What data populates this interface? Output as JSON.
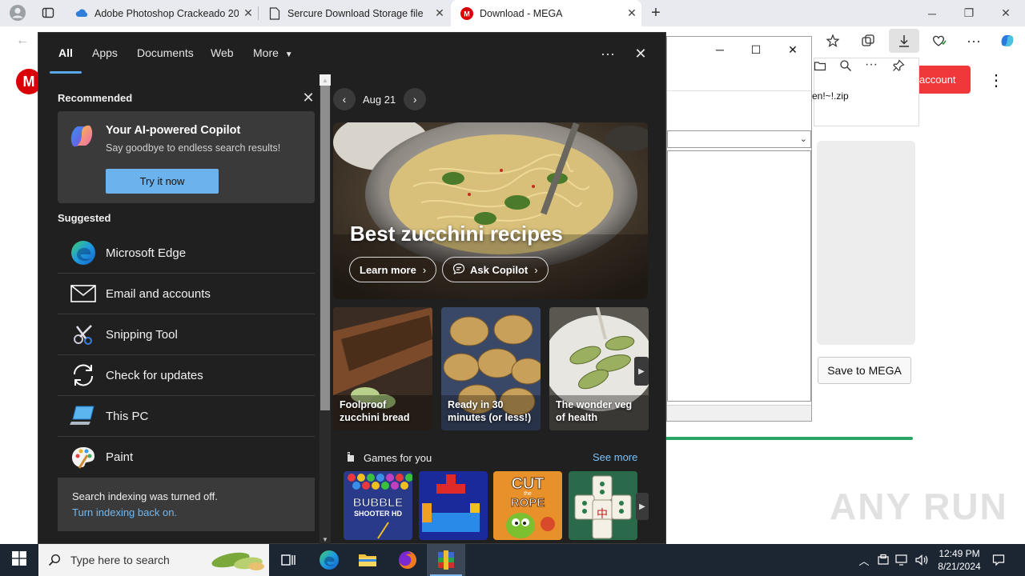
{
  "browser": {
    "tabs": [
      {
        "title": "Adobe Photoshop Crackeado 20",
        "active": false
      },
      {
        "title": "Sercure Download Storage file",
        "active": false
      },
      {
        "title": "Download - MEGA",
        "active": true
      }
    ],
    "new_tab": "+"
  },
  "mega": {
    "logo": "M",
    "account_button": "account",
    "save_button": "Save to MEGA",
    "progress_percent": 100
  },
  "download_window": {
    "filename": "en!~!.zip"
  },
  "flyout": {
    "nav": {
      "tabs": [
        "All",
        "Apps",
        "Documents",
        "Web",
        "More"
      ],
      "more_menu": "···",
      "close": "✕"
    },
    "recommended": {
      "heading": "Recommended",
      "card_title": "Your AI-powered Copilot",
      "card_subtitle": "Say goodbye to endless search results!",
      "card_button": "Try it now"
    },
    "suggested": {
      "heading": "Suggested",
      "items": [
        {
          "label": "Microsoft Edge",
          "icon": "edge-icon"
        },
        {
          "label": "Email and accounts",
          "icon": "mail-icon"
        },
        {
          "label": "Snipping Tool",
          "icon": "snipping-tool-icon"
        },
        {
          "label": "Check for updates",
          "icon": "refresh-icon"
        },
        {
          "label": "This PC",
          "icon": "computer-icon"
        },
        {
          "label": "Paint",
          "icon": "paint-icon"
        }
      ]
    },
    "indexing": {
      "message": "Search indexing was turned off.",
      "link": "Turn indexing back on."
    },
    "news": {
      "date": "Aug 21",
      "hero_title": "Best zucchini recipes",
      "hero_learn_more": "Learn more",
      "hero_ask_copilot": "Ask Copilot",
      "tiles": [
        {
          "caption_line1": "Foolproof",
          "caption_line2": "zucchini bread"
        },
        {
          "caption_line1": "Ready in 30",
          "caption_line2": "minutes (or less!)"
        },
        {
          "caption_line1": "The wonder veg",
          "caption_line2": "of health"
        }
      ],
      "games_heading": "Games for you",
      "see_more": "See more",
      "games": [
        {
          "name": "BUBBLE SHOOTER HD"
        },
        {
          "name": "Block puzzle"
        },
        {
          "name": "CUT the ROPE"
        },
        {
          "name": "Mahjong"
        }
      ]
    }
  },
  "taskbar": {
    "search_placeholder": "Type here to search",
    "time": "12:49 PM",
    "date": "8/21/2024"
  },
  "watermark": "ANY RUN",
  "colors": {
    "flyout_bg": "#202020",
    "accent_blue": "#6cb2ec",
    "mega_red": "#d90007",
    "taskbar_bg": "#1c2633"
  }
}
